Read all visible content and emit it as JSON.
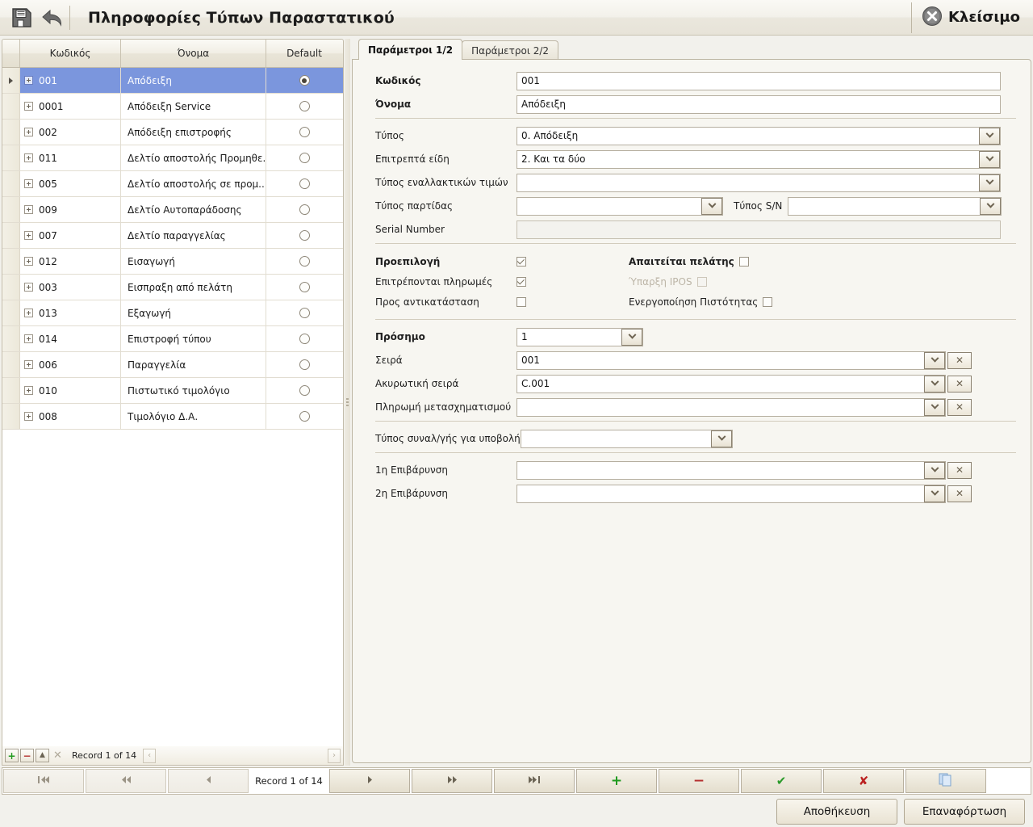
{
  "titlebar": {
    "title": "Πληροφορίες Τύπων Παραστατικού",
    "save_icon": "floppy-disk-icon",
    "undo_icon": "undo-arrow-icon",
    "close_label": "Κλείσιμο"
  },
  "grid": {
    "columns": [
      "Κωδικός",
      "Όνομα",
      "Default"
    ],
    "rows": [
      {
        "code": "001",
        "name": "Απόδειξη",
        "default": true
      },
      {
        "code": "0001",
        "name": "Απόδειξη Service",
        "default": false
      },
      {
        "code": "002",
        "name": "Απόδειξη επιστροφής",
        "default": false
      },
      {
        "code": "011",
        "name": "Δελτίο αποστολής Προμηθε...",
        "default": false
      },
      {
        "code": "005",
        "name": "Δελτίο αποστολής σε προμ...",
        "default": false
      },
      {
        "code": "009",
        "name": "Δελτίο Αυτοπαράδοσης",
        "default": false
      },
      {
        "code": "007",
        "name": "Δελτίο παραγγελίας",
        "default": false
      },
      {
        "code": "012",
        "name": "Εισαγωγή",
        "default": false
      },
      {
        "code": "003",
        "name": "Εισπραξη από πελάτη",
        "default": false
      },
      {
        "code": "013",
        "name": "Εξαγωγή",
        "default": false
      },
      {
        "code": "014",
        "name": "Επιστροφή τύπου",
        "default": false
      },
      {
        "code": "006",
        "name": "Παραγγελία",
        "default": false
      },
      {
        "code": "010",
        "name": "Πιστωτικό τιμολόγιο",
        "default": false
      },
      {
        "code": "008",
        "name": "Τιμολόγιο Δ.Α.",
        "default": false
      }
    ],
    "selected_index": 0,
    "footer": {
      "add_label": "+",
      "delete_label": "−",
      "edit_label": "▲",
      "cancel_label": "✕",
      "record_text": "Record 1 of 14",
      "prev_label": "‹",
      "next_label": "›"
    }
  },
  "tabs": [
    {
      "label": "Παράμετροι 1/2",
      "active": true
    },
    {
      "label": "Παράμετροι 2/2",
      "active": false
    }
  ],
  "form": {
    "kodikos": {
      "label": "Κωδικός",
      "value": "001"
    },
    "onoma": {
      "label": "Όνομα",
      "value": "Απόδειξη"
    },
    "typos": {
      "label": "Τύπος",
      "value": "0. Απόδειξη"
    },
    "epitrepta_eidi": {
      "label": "Επιτρεπτά είδη",
      "value": "2. Και τα δύο"
    },
    "typos_enallaktikon": {
      "label": "Τύπος εναλλακτικών τιμών",
      "value": ""
    },
    "typos_partidas": {
      "label": "Τύπος παρτίδας",
      "value": ""
    },
    "typos_sn": {
      "label": "Τύπος S/N",
      "value": ""
    },
    "serial_number": {
      "label": "Serial Number",
      "value": ""
    },
    "checkboxes": {
      "proepilogi": {
        "label": "Προεπιλογή",
        "checked": true,
        "bold": true,
        "disabled": false
      },
      "epitreponte_pliromes": {
        "label": "Επιτρέπονται πληρωμές",
        "checked": true,
        "bold": false,
        "disabled": false
      },
      "pros_antikatastasi": {
        "label": "Προς αντικατάσταση",
        "checked": false,
        "bold": false,
        "disabled": false
      },
      "apaiteitai_pelatis": {
        "label": "Απαιτείται πελάτης",
        "checked": false,
        "bold": true,
        "disabled": false
      },
      "yparxi_ipos": {
        "label": "Ύπαρξη IPOS",
        "checked": false,
        "bold": false,
        "disabled": true
      },
      "energopoiisi_pistotitas": {
        "label": "Ενεργοποίηση Πιστότητας",
        "checked": false,
        "bold": false,
        "disabled": false
      }
    },
    "prosimo": {
      "label": "Πρόσημο",
      "value": "1"
    },
    "seira": {
      "label": "Σειρά",
      "value": "001"
    },
    "akyrotiki_seira": {
      "label": "Ακυρωτική σειρά",
      "value": "C.001"
    },
    "pliromi_metasximatismou": {
      "label": "Πληρωμή μετασχηματισμού",
      "value": ""
    },
    "typos_synal": {
      "label": "Τύπος συναλ/γής για υποβολή",
      "value": ""
    },
    "epivarynsi1": {
      "label": "1η Επιβάρυνση",
      "value": ""
    },
    "epivarynsi2": {
      "label": "2η Επιβάρυνση",
      "value": ""
    },
    "clear_button_label": "✕"
  },
  "navigator": {
    "first_label": "⏮",
    "prior_page_label": "◀◀",
    "prior_label": "◀",
    "record_text": "Record 1 of 14",
    "next_label": "▶",
    "next_page_label": "▶▶",
    "last_label": "⏭",
    "insert_label": "+",
    "delete_label": "−",
    "post_label": "✔",
    "cancel_label": "✘",
    "refresh_label": "refresh-icon"
  },
  "actions": {
    "save_label": "Αποθήκευση",
    "reload_label": "Επαναφόρτωση"
  },
  "colors": {
    "selection": "#7b96dd",
    "window_bg": "#f2f1ec",
    "panel_bg": "#f7f6f1",
    "border": "#bdb6a4",
    "accent_green": "#1f9a1f",
    "accent_red": "#b53030"
  }
}
